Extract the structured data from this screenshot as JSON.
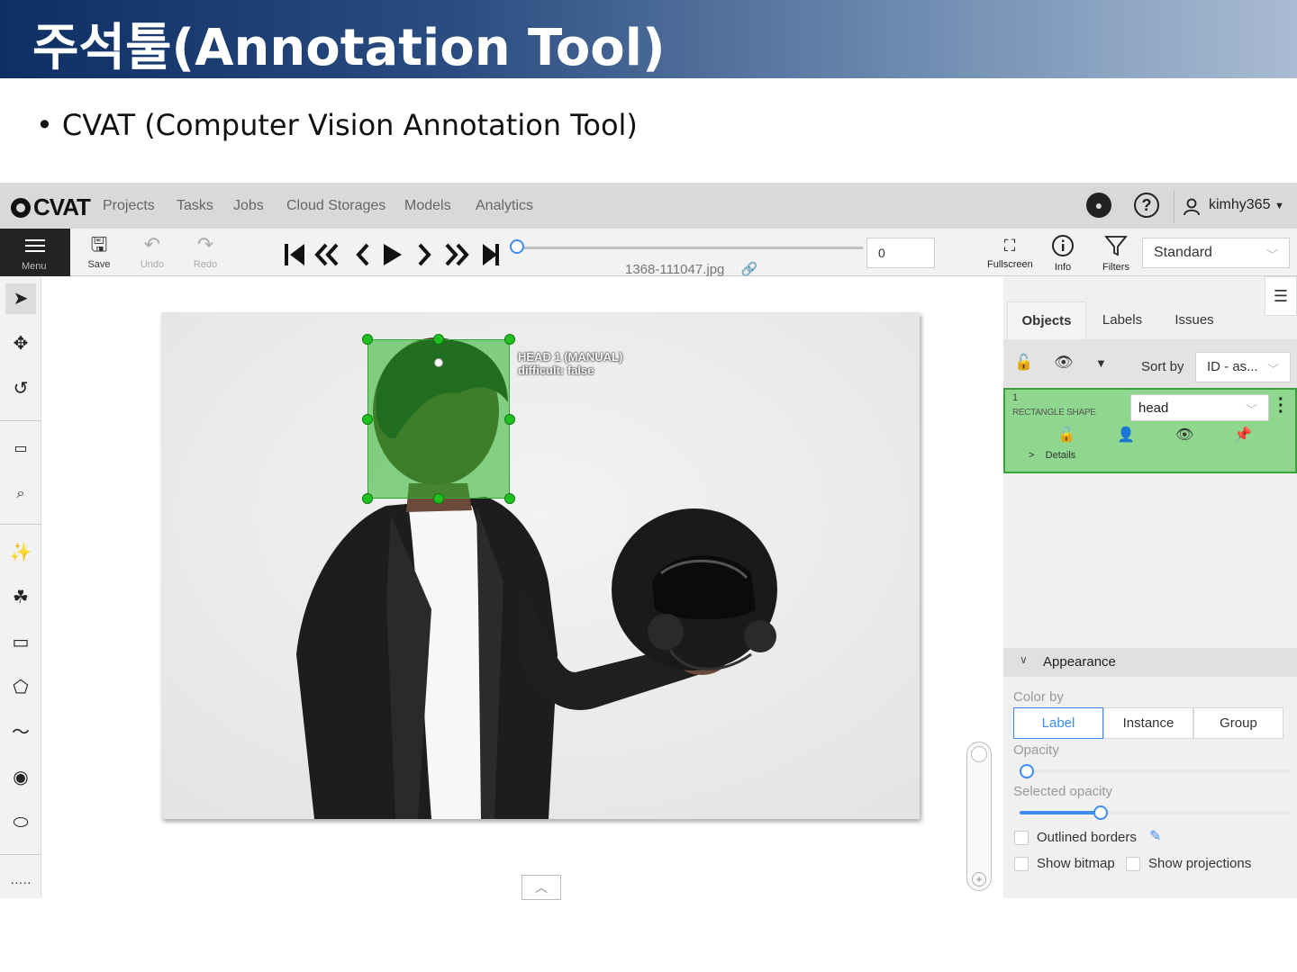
{
  "slide": {
    "title": "주석툴(Annotation Tool)",
    "bullet": "CVAT (Computer Vision Annotation Tool)"
  },
  "app": {
    "logo": "CVAT",
    "nav": [
      "Projects",
      "Tasks",
      "Jobs",
      "Cloud Storages",
      "Models",
      "Analytics"
    ],
    "user": "kimhy365",
    "toolbar": {
      "menu_label": "Menu",
      "save_label": "Save",
      "undo_label": "Undo",
      "redo_label": "Redo",
      "filename": "1368-111047.jpg",
      "frame_value": "0",
      "fullscreen_label": "Fullscreen",
      "info_label": "Info",
      "filters_label": "Filters",
      "workspace_value": "Standard"
    },
    "canvas": {
      "bbox_label_line1": "HEAD 1 (MANUAL)",
      "bbox_label_line2": "difficult: false",
      "bbox_color": "#28b428"
    },
    "sidebar": {
      "tabs": [
        "Objects",
        "Labels",
        "Issues"
      ],
      "sort_by_label": "Sort by",
      "sort_value": "ID - as...",
      "object": {
        "id": "1",
        "type": "RECTANGLE SHAPE",
        "label_value": "head",
        "details_label": "Details",
        "color": "#8fd68f"
      },
      "appearance": {
        "title": "Appearance",
        "color_by_label": "Color by",
        "color_by_options": [
          "Label",
          "Instance",
          "Group"
        ],
        "color_by_selected": "Label",
        "opacity_label": "Opacity",
        "opacity_value": 0.0,
        "selected_opacity_label": "Selected opacity",
        "selected_opacity_value": 0.3,
        "outlined_borders_label": "Outlined borders",
        "show_bitmap_label": "Show bitmap",
        "show_projections_label": "Show projections"
      }
    }
  }
}
